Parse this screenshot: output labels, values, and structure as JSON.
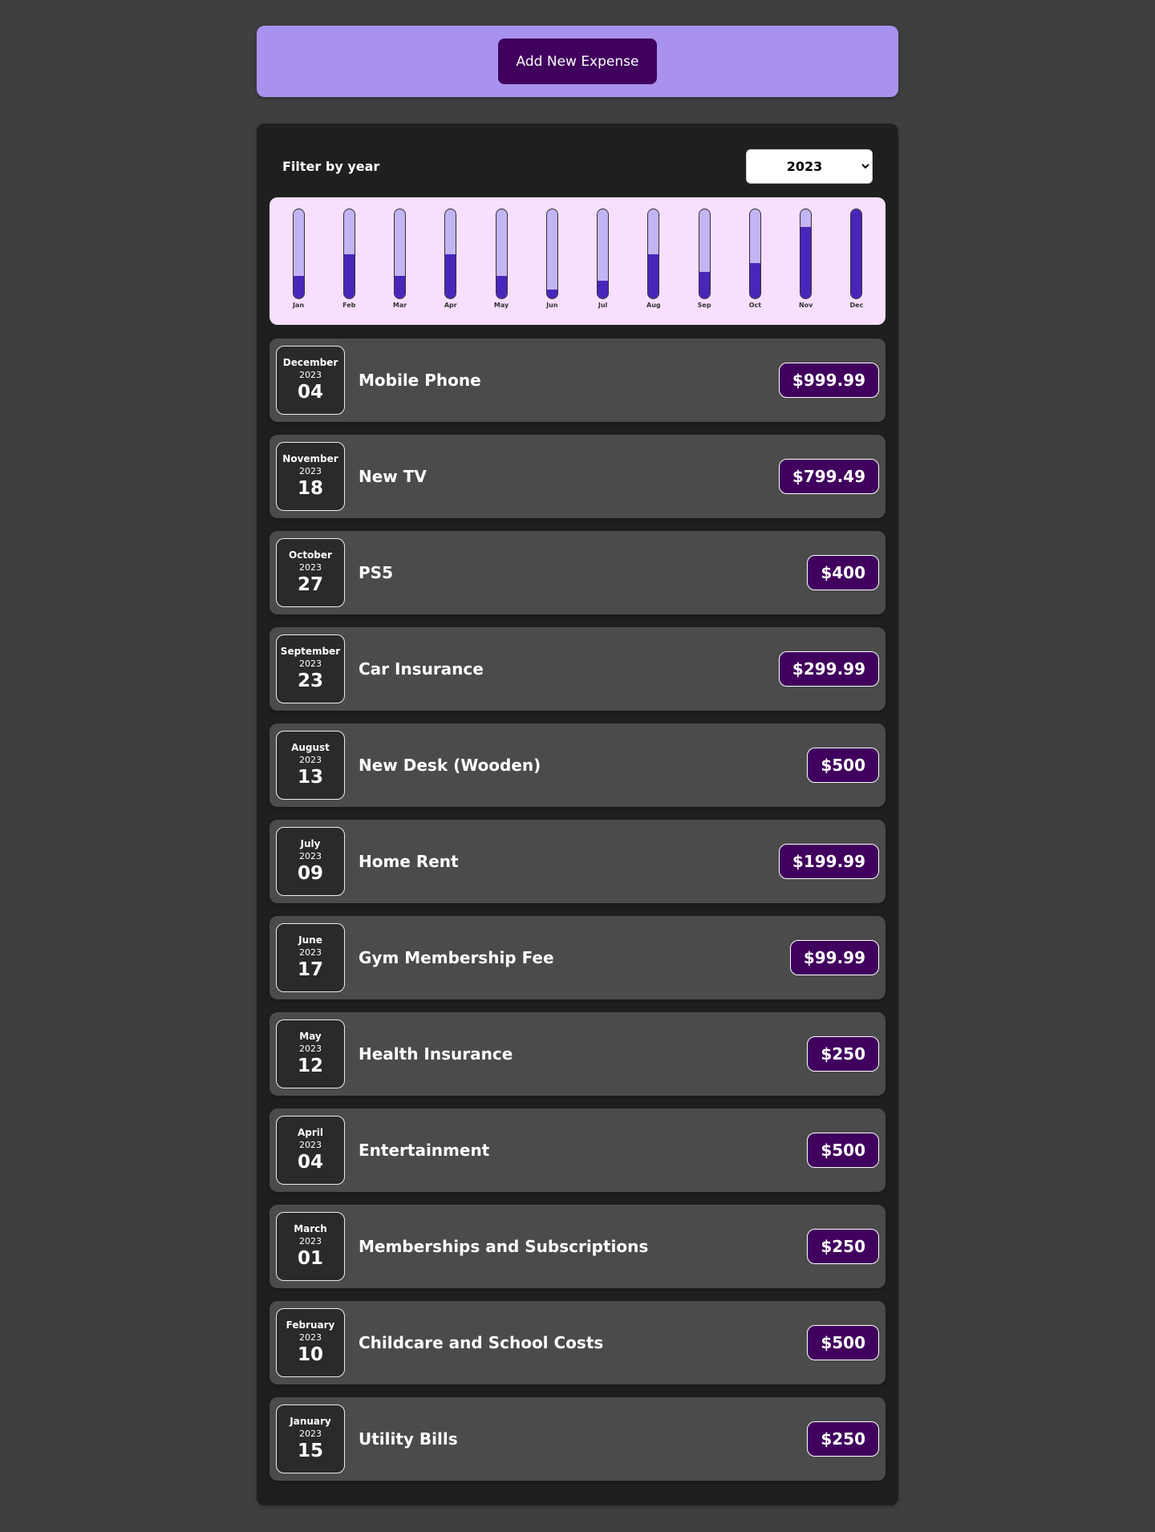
{
  "new_expense": {
    "button_label": "Add New Expense"
  },
  "filter": {
    "label": "Filter by year",
    "selected_year": "2023"
  },
  "chart_data": {
    "type": "bar",
    "categories": [
      "Jan",
      "Feb",
      "Mar",
      "Apr",
      "May",
      "Jun",
      "Jul",
      "Aug",
      "Sep",
      "Oct",
      "Nov",
      "Dec"
    ],
    "values": [
      250,
      500,
      250,
      500,
      250,
      99.99,
      199.99,
      500,
      299.99,
      400,
      799.49,
      999.99
    ],
    "ylim": [
      0,
      999.99
    ]
  },
  "expenses": [
    {
      "month": "December",
      "year": "2023",
      "day": "04",
      "title": "Mobile Phone",
      "amount": "$999.99"
    },
    {
      "month": "November",
      "year": "2023",
      "day": "18",
      "title": "New TV",
      "amount": "$799.49"
    },
    {
      "month": "October",
      "year": "2023",
      "day": "27",
      "title": "PS5",
      "amount": "$400"
    },
    {
      "month": "September",
      "year": "2023",
      "day": "23",
      "title": "Car Insurance",
      "amount": "$299.99"
    },
    {
      "month": "August",
      "year": "2023",
      "day": "13",
      "title": "New Desk (Wooden)",
      "amount": "$500"
    },
    {
      "month": "July",
      "year": "2023",
      "day": "09",
      "title": "Home Rent",
      "amount": "$199.99"
    },
    {
      "month": "June",
      "year": "2023",
      "day": "17",
      "title": "Gym Membership Fee",
      "amount": "$99.99"
    },
    {
      "month": "May",
      "year": "2023",
      "day": "12",
      "title": "Health Insurance",
      "amount": "$250"
    },
    {
      "month": "April",
      "year": "2023",
      "day": "04",
      "title": "Entertainment",
      "amount": "$500"
    },
    {
      "month": "March",
      "year": "2023",
      "day": "01",
      "title": "Memberships and Subscriptions",
      "amount": "$250"
    },
    {
      "month": "February",
      "year": "2023",
      "day": "10",
      "title": "Childcare and School Costs",
      "amount": "$500"
    },
    {
      "month": "January",
      "year": "2023",
      "day": "15",
      "title": "Utility Bills",
      "amount": "$250"
    }
  ]
}
